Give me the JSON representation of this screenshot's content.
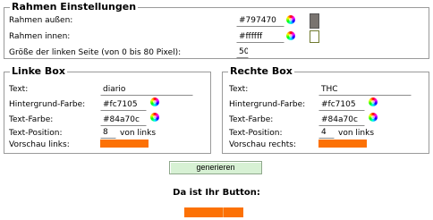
{
  "rahmen": {
    "legend": "Rahmen Einstellungen",
    "outer_label": "Rahmen außen:",
    "outer_value": "#797470",
    "inner_label": "Rahmen innen:",
    "inner_value": "#ffffff",
    "left_width_label": "Größe der linken Seite (von 0 bis 80 Pixel):",
    "left_width_value": "50",
    "outer_color": "#797470",
    "inner_color": "#ffffff"
  },
  "linke_box": {
    "legend": "Linke Box",
    "text_label": "Text:",
    "text_value": "diario",
    "bg_label": "Hintergrund-Farbe:",
    "bg_value": "#fc7105",
    "fg_label": "Text-Farbe:",
    "fg_value": "#84a70c",
    "pos_label": "Text-Position:",
    "pos_value": "8",
    "pos_suffix": "von links",
    "preview_label": "Vorschau links:",
    "preview_color": "#fc7105"
  },
  "rechte_box": {
    "legend": "Rechte Box",
    "text_label": "Text:",
    "text_value": "THC",
    "bg_label": "Hintergrund-Farbe:",
    "bg_value": "#fc7105",
    "fg_label": "Text-Farbe:",
    "fg_value": "#84a70c",
    "pos_label": "Text-Position:",
    "pos_value": "4",
    "pos_suffix": "von links",
    "preview_label": "Vorschau rechts:",
    "preview_color": "#fc7105"
  },
  "actions": {
    "generate_label": "generieren"
  },
  "result": {
    "title": "Da ist Ihr Button:",
    "left_color": "#fc7105",
    "right_color": "#fc7105",
    "divider_color": "#f4a75f"
  },
  "icons": {
    "color_picker": "color-wheel-icon"
  }
}
